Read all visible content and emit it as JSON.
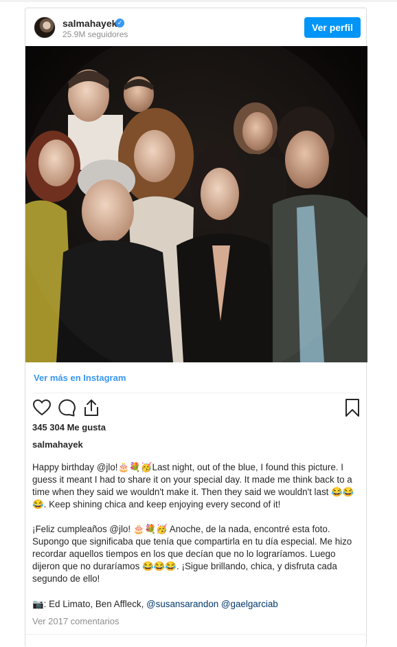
{
  "post": {
    "username": "salmahayek",
    "followers": "25.9M seguidores",
    "view_profile_label": "Ver perfil",
    "view_more_label": "Ver más en Instagram",
    "likes": "345 304 Me gusta",
    "caption_username": "salmahayek",
    "caption_english": "Happy birthday @jlo!🎂💐🥳Last night, out of the blue, I found this picture. I guess it meant I had to share it on your special day. It made me think back to a time when they said we wouldn't make it. Then they said we wouldn't last 😂😂😂. Keep shining chica and keep enjoying every second of it!",
    "caption_spanish": "¡Feliz cumpleaños @jlo! 🎂💐🥳 Anoche, de la nada, encontré esta foto. Supongo que significaba que tenía que compartirla en tu día especial. Me hizo recordar aquellos tiempos en los que decían que no lo lograríamos. Luego dijeron que no duraríamos 😂😂😂. ¡Sigue brillando, chica, y disfruta cada segundo de ello!",
    "credits_prefix": "📷: Ed Limato, Ben Affleck, ",
    "credits_handles": "@susansarandon @gaelgarciab",
    "view_comments_label": "Ver 2017 comentarios"
  },
  "colors": {
    "accent": "#0095f6",
    "link": "#3897f0",
    "verified": "#3897f0"
  },
  "icons": [
    "verified-badge-icon",
    "heart-icon",
    "comment-icon",
    "share-icon",
    "bookmark-icon"
  ]
}
